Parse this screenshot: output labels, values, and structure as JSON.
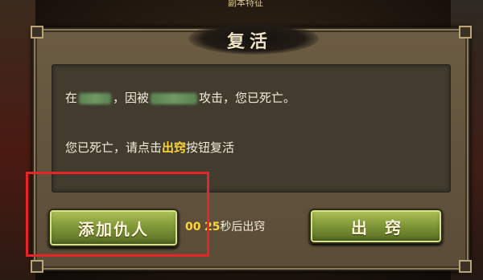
{
  "banner": {
    "text": "副本特征"
  },
  "dialog": {
    "title": "复活",
    "line1": {
      "prefix": "在",
      "middle": "，因被",
      "suffix": "攻击，您已死亡。"
    },
    "line2": {
      "prefix": "您已死亡，请点击",
      "highlight": "出窍",
      "suffix": "按钮复活"
    }
  },
  "buttons": {
    "add_enemy": "添加仇人",
    "exit_body": "出窍"
  },
  "timer": {
    "minutes": "00",
    "seconds": "25",
    "suffix": "秒后出窍"
  },
  "colors": {
    "highlight_text": "#ffd53a",
    "annotation_border": "#e6252a",
    "button_green": "#7d9437"
  }
}
